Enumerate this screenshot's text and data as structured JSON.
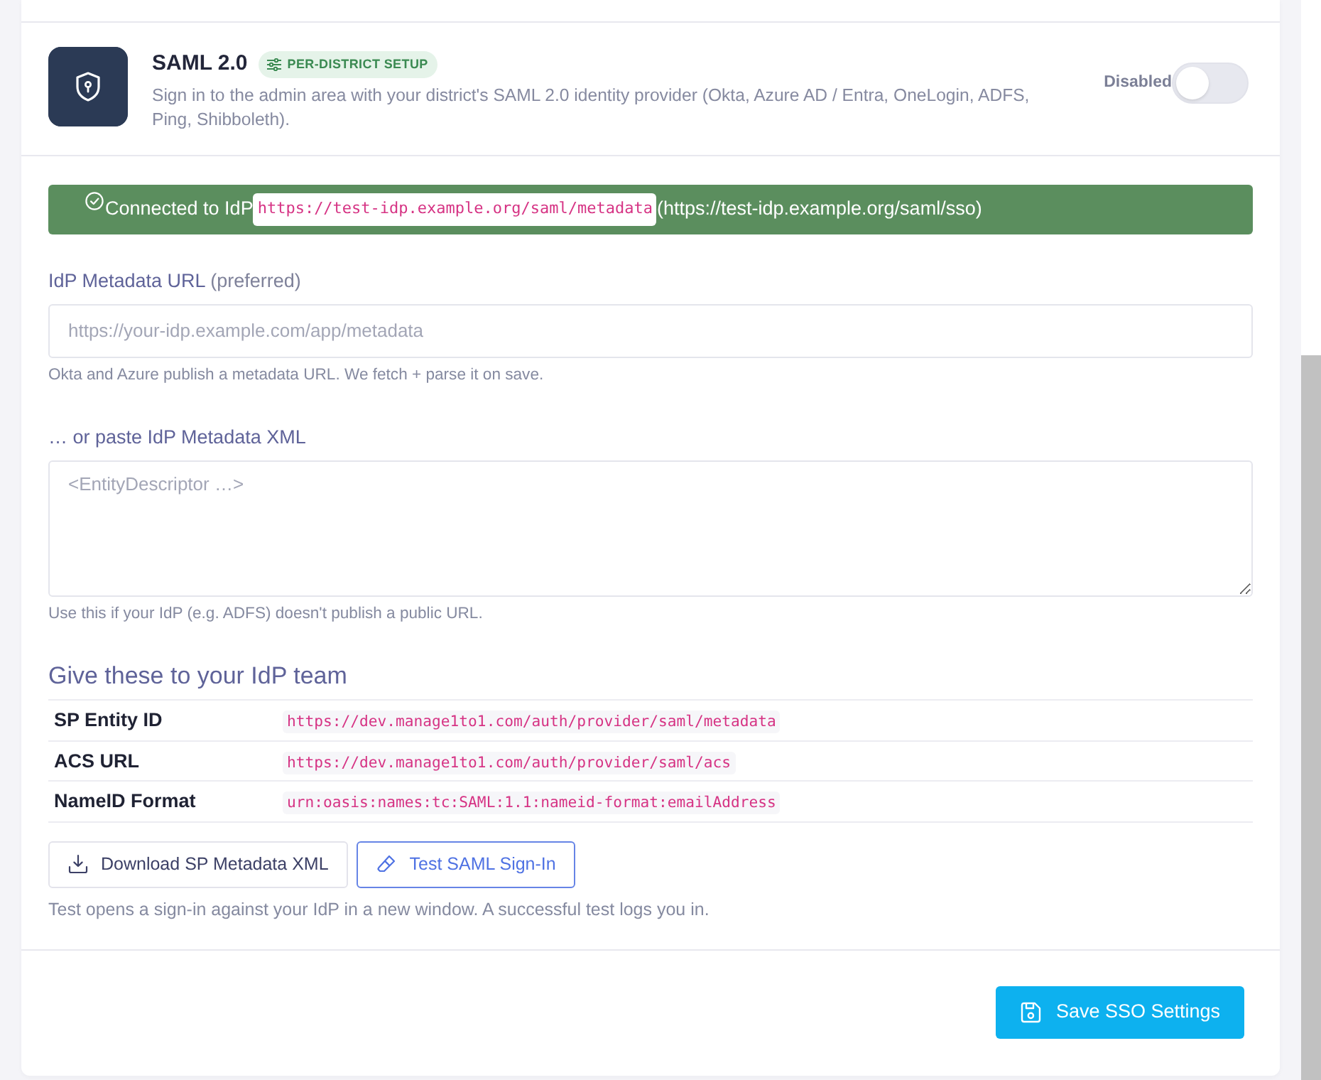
{
  "provider": {
    "title": "SAML 2.0",
    "badge": "PER-DISTRICT SETUP",
    "description": "Sign in to the admin area with your district's SAML 2.0 identity provider (Okta, Azure AD / Entra, OneLogin, ADFS, Ping, Shibboleth).",
    "toggle": {
      "label": "Disabled",
      "on": false
    }
  },
  "status_alert": {
    "prefix": "Connected to IdP",
    "entity": "https://test-idp.example.org/saml/metadata",
    "sso_url": "(https://test-idp.example.org/saml/sso)"
  },
  "fields": [
    {
      "kind": "input",
      "label": "IdP Metadata URL",
      "note": "(preferred)",
      "placeholder": "https://your-idp.example.com/app/metadata",
      "help": "Okta and Azure publish a metadata URL. We fetch + parse it on save."
    },
    {
      "kind": "textarea",
      "label": "… or paste IdP Metadata XML",
      "placeholder": "<EntityDescriptor …>",
      "help": "Use this if your IdP (e.g. ADFS) doesn't publish a public URL."
    }
  ],
  "sp_info": {
    "heading": "Give these to your IdP team",
    "rows": [
      {
        "label": "SP Entity ID",
        "value": "https://dev.manage1to1.com/auth/provider/saml/metadata"
      },
      {
        "label": "ACS URL",
        "value": "https://dev.manage1to1.com/auth/provider/saml/acs"
      },
      {
        "label": "NameID Format",
        "value": "urn:oasis:names:tc:SAML:1.1:nameid-format:emailAddress"
      }
    ]
  },
  "actions": [
    {
      "kind": "download",
      "label": "Download SP Metadata XML"
    },
    {
      "kind": "test",
      "label": "Test SAML Sign-In"
    }
  ],
  "actions_help": "Test opens a sign-in against your IdP in a new window. A successful test logs you in.",
  "save_button": "Save SSO Settings"
}
